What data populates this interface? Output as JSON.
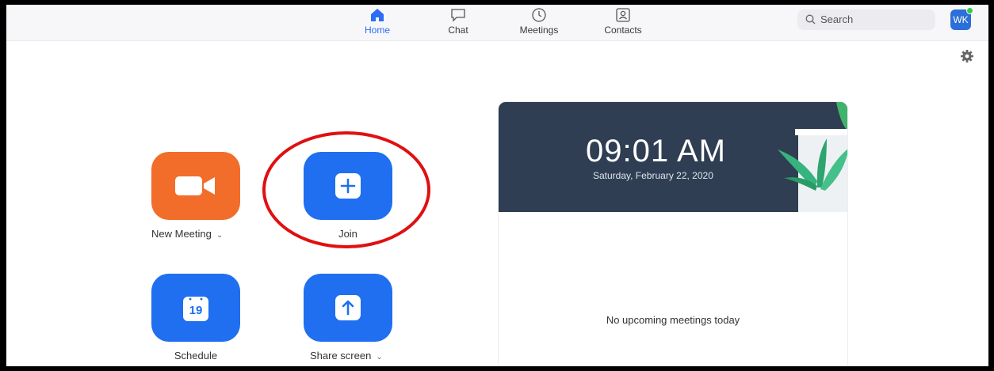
{
  "nav": {
    "tabs": [
      {
        "label": "Home",
        "icon": "home-icon",
        "active": true
      },
      {
        "label": "Chat",
        "icon": "chat-icon",
        "active": false
      },
      {
        "label": "Meetings",
        "icon": "clock-icon",
        "active": false
      },
      {
        "label": "Contacts",
        "icon": "contacts-icon",
        "active": false
      }
    ]
  },
  "search": {
    "placeholder": "Search"
  },
  "user": {
    "initials": "WK",
    "status_color": "#2ecc40"
  },
  "actions": {
    "new_meeting": {
      "label": "New Meeting",
      "color": "#f26d2a"
    },
    "join": {
      "label": "Join",
      "color": "#1f6ff0"
    },
    "schedule": {
      "label": "Schedule",
      "calendar_day": "19",
      "color": "#1f6ff0"
    },
    "share_screen": {
      "label": "Share screen",
      "color": "#1f6ff0"
    }
  },
  "calendar": {
    "time": "09:01 AM",
    "date": "Saturday, February 22, 2020",
    "empty_message": "No upcoming meetings today"
  },
  "colors": {
    "accent": "#2d6df6",
    "highlight_circle": "#e01010"
  }
}
